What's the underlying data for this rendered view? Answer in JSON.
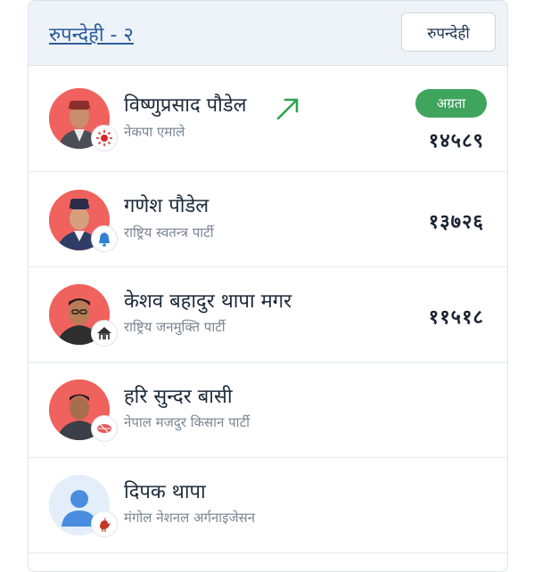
{
  "header": {
    "district_title": "रुपन्देही - २",
    "district_button": "रुपन्देही"
  },
  "candidates": [
    {
      "name": "विष्णुप्रसाद पौडेल",
      "party": "नेकपा एमाले",
      "votes": "१४५८९",
      "badge": "अग्रता",
      "trend_icon": "trending-up-icon",
      "party_icon": "sun-icon"
    },
    {
      "name": "गणेश पौडेल",
      "party": "राष्ट्रिय स्वतन्त्र पार्टी",
      "votes": "१३७२६",
      "party_icon": "bell-icon"
    },
    {
      "name": "केशव बहादुर थापा मगर",
      "party": "राष्ट्रिय जनमुक्ति पार्टी",
      "votes": "११५१८",
      "party_icon": "house-icon"
    },
    {
      "name": "हरि सुन्दर बासी",
      "party": "नेपाल मजदुर किसान पार्टी",
      "votes": "",
      "party_icon": "madal-icon"
    },
    {
      "name": "दिपक थापा",
      "party": "मंगोल नेशनल अर्गनाइजेसन",
      "votes": "",
      "party_icon": "rooster-icon"
    }
  ],
  "colors": {
    "accent": "#2b5d9b",
    "lead_badge": "#3fa45c",
    "avatar_bg": "#f0625e",
    "trend_arrow": "#2ea44f"
  }
}
